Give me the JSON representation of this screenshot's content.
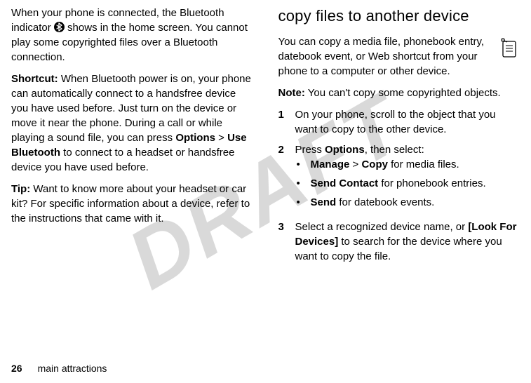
{
  "watermark": "DRAFT",
  "left": {
    "p1a": "When your phone is connected, the Bluetooth indicator ",
    "p1b": " shows in the home screen. You cannot play some copyrighted files over a Bluetooth connection.",
    "shortcut_label": "Shortcut:",
    "shortcut_a": " When Bluetooth power is on, your phone can automatically connect to a handsfree device you have used before. Just turn on the device or move it near the phone. During a call or while playing a sound file, you can press ",
    "options": "Options",
    "gt": " > ",
    "use_bt": "Use Bluetooth",
    "shortcut_b": " to connect to a headset or handsfree device you have used before.",
    "tip_label": "Tip:",
    "tip_text": " Want to know more about your headset or car kit? For specific information about a device, refer to the instructions that came with it."
  },
  "right": {
    "heading": "copy files to another device",
    "intro": "You can copy a media file, phonebook entry, datebook event, or Web shortcut from your phone to a computer or other device.",
    "note_label": "Note:",
    "note_text": " You can't copy some copyrighted objects.",
    "steps": [
      {
        "n": "1",
        "text": "On your phone, scroll to the object that you want to copy to the other device."
      },
      {
        "n": "2",
        "a": "Press ",
        "b": "Options",
        "c": ", then select:"
      },
      {
        "n": "3",
        "a": "Select a recognized device name, or ",
        "b": "[Look For Devices]",
        "c": " to search for the device where you want to copy the file."
      }
    ],
    "bullets": [
      {
        "a": "Manage",
        "b": " > ",
        "c": "Copy",
        "d": " for media files."
      },
      {
        "a": "Send Contact",
        "d": " for phonebook entries."
      },
      {
        "a": "Send",
        "d": " for datebook events."
      }
    ]
  },
  "footer": {
    "page": "26",
    "section": "main attractions"
  },
  "icons": {
    "bt": "bluetooth-icon",
    "copy": "copy-file-icon"
  }
}
